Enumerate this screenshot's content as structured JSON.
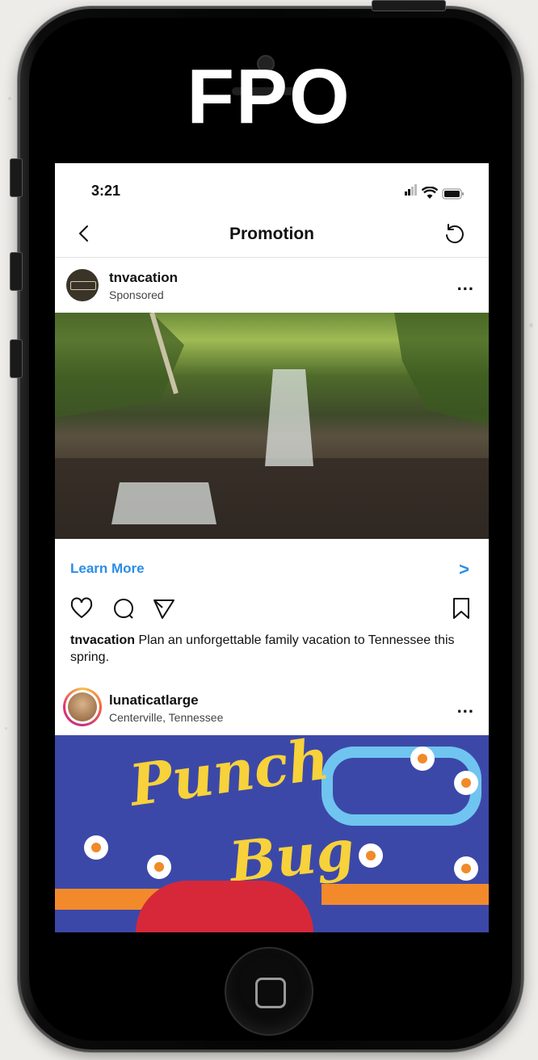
{
  "overlay": {
    "label": "FPO"
  },
  "status_bar": {
    "time": "3:21"
  },
  "nav": {
    "title": "Promotion",
    "back_icon": "chevron-left-icon",
    "refresh_icon": "refresh-icon"
  },
  "post1": {
    "username": "tnvacation",
    "subtitle": "Sponsored",
    "more": "...",
    "image_alt": "waterfall",
    "cta_label": "Learn More",
    "cta_chevron": ">",
    "caption_user": "tnvacation",
    "caption_text": " Plan an unforgettable family vacation to Tennessee this spring."
  },
  "post2": {
    "username": "lunaticatlarge",
    "location": "Centerville, Tennessee",
    "more": "...",
    "image_title": "Punch",
    "image_subtitle": "Bug"
  },
  "colors": {
    "link": "#2a8de8",
    "text": "#111111",
    "phone": "#050505"
  }
}
